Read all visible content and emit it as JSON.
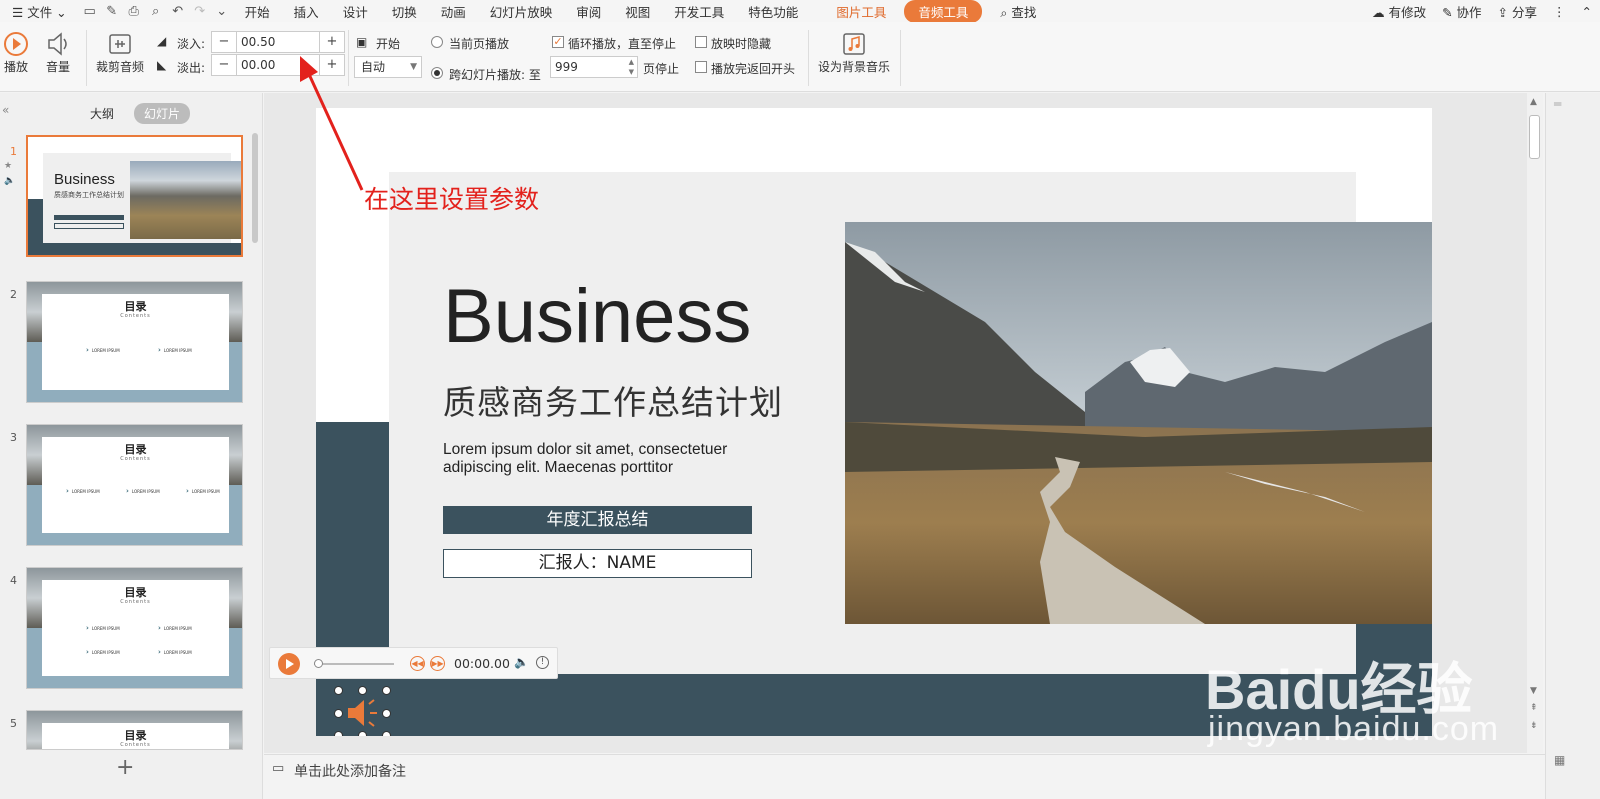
{
  "menubar": {
    "file_label": "文件",
    "tabs": [
      "开始",
      "插入",
      "设计",
      "切换",
      "动画",
      "幻灯片放映",
      "审阅",
      "视图",
      "开发工具",
      "特色功能"
    ],
    "picture_tools": "图片工具",
    "audio_tools": "音频工具",
    "search": "查找",
    "right": {
      "modified": "有修改",
      "collab": "协作",
      "share": "分享"
    }
  },
  "ribbon": {
    "play": "播放",
    "volume": "音量",
    "trim": "裁剪音频",
    "fade_in_label": "淡入:",
    "fade_in_value": "00.50",
    "fade_out_label": "淡出:",
    "fade_out_value": "00.00",
    "start_label": "开始",
    "start_select": "自动",
    "current_page": "当前页播放",
    "cross_slides": "跨幻灯片播放: 至",
    "cross_slides_value": "999",
    "stop_at_page": "页停止",
    "loop": "循环播放，直至停止",
    "hide_when_playing": "放映时隐藏",
    "rewind_after": "播放完返回开头",
    "bg_music": "设为背景音乐"
  },
  "leftpanel": {
    "tab_outline": "大纲",
    "tab_slides": "幻灯片",
    "thumbs": [
      {
        "num": "1",
        "title": "Business",
        "sub": "质感商务工作总结计划"
      },
      {
        "num": "2",
        "title": "目录",
        "sub": "Contents",
        "item": "LOREM IPSUM"
      },
      {
        "num": "3",
        "title": "目录",
        "sub": "Contents",
        "item": "LOREM IPSUM"
      },
      {
        "num": "4",
        "title": "目录",
        "sub": "Contents",
        "item": "LOREM IPSUM"
      },
      {
        "num": "5",
        "title": "目录",
        "sub": "Contents"
      }
    ]
  },
  "slide": {
    "title": "Business",
    "subtitle": "质感商务工作总结计划",
    "body": "Lorem ipsum dolor sit amet, consectetuer adipiscing elit. Maecenas porttitor",
    "bar_text": "年度汇报总结",
    "reporter": "汇报人：NAME"
  },
  "player": {
    "time": "00:00.00"
  },
  "notes": {
    "placeholder": "单击此处添加备注"
  },
  "annotation": {
    "text": "在这里设置参数"
  },
  "watermark": {
    "logo": "Baidu经验",
    "url": "jingyan.baidu.com"
  },
  "colors": {
    "accent": "#ea7a3a",
    "slate": "#3b525e",
    "annotation_red": "#e3211c"
  }
}
